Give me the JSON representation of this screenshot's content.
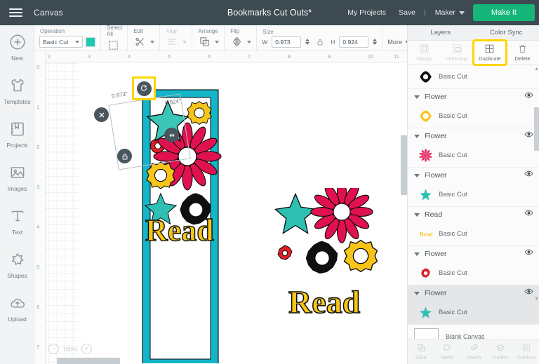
{
  "topbar": {
    "menu_icon": "hamburger-icon",
    "canvas_label": "Canvas",
    "doc_title": "Bookmarks Cut Outs*",
    "my_projects": "My Projects",
    "save": "Save",
    "separator": "|",
    "machine": "Maker",
    "make_it": "Make It",
    "accent_green": "#16b579",
    "bar_bg": "#3d4a51"
  },
  "rail": {
    "items": [
      {
        "label": "New",
        "icon": "plus-circle-icon"
      },
      {
        "label": "Templates",
        "icon": "shirt-icon"
      },
      {
        "label": "Projects",
        "icon": "book-icon"
      },
      {
        "label": "Images",
        "icon": "image-icon"
      },
      {
        "label": "Text",
        "icon": "text-t-icon"
      },
      {
        "label": "Shapes",
        "icon": "shapes-icon"
      },
      {
        "label": "Upload",
        "icon": "upload-cloud-icon"
      }
    ]
  },
  "toolbar": {
    "operation_label": "Operation",
    "operation_value": "Basic Cut",
    "operation_color": "#1fc9b0",
    "select_all_label": "Select All",
    "edit_label": "Edit",
    "align_label": "Align",
    "arrange_label": "Arrange",
    "flip_label": "Flip",
    "size_label": "Size",
    "w_label": "W",
    "w_value": "0.973",
    "h_label": "H",
    "h_value": "0.924",
    "lock_icon": "lock-icon",
    "more_label": "More"
  },
  "canvas": {
    "ruler_h": [
      "2",
      "3",
      "4",
      "5",
      "6",
      "7",
      "8",
      "9",
      "10",
      "11"
    ],
    "ruler_v": [
      "0",
      "1",
      "2",
      "3",
      "4",
      "5",
      "6",
      "7"
    ],
    "zoom_percent": "100%",
    "zoom_out_icon": "minus-circle-icon",
    "zoom_in_icon": "plus-circle-icon",
    "selection": {
      "width_label": "0.973\"",
      "height_label": "0.924\"",
      "delete_icon": "close-x-icon",
      "lock_icon": "lock-closed-icon",
      "resize_icon": "resize-diagonal-icon",
      "rotate_icon": "rotate-icon",
      "rotate_highlight_color": "#ffd400"
    },
    "artwork": {
      "bookmark_frame_color": "#14b5c9",
      "shapes": [
        {
          "name": "teal-star-flower",
          "color": "#2fc0b4"
        },
        {
          "name": "crimson-daisy",
          "color": "#e0114f"
        },
        {
          "name": "small-red-flower",
          "color": "#e01e28"
        },
        {
          "name": "black-flower",
          "color": "#101010"
        },
        {
          "name": "yellow-ring-flower",
          "color": "#f7c51a"
        },
        {
          "name": "read-word",
          "color": "#f7c51a",
          "text": "Read"
        }
      ]
    }
  },
  "right_panel": {
    "tabs": [
      {
        "label": "Layers"
      },
      {
        "label": "Color Sync"
      }
    ],
    "ops": [
      {
        "label": "Group",
        "icon": "group-icon",
        "enabled": false,
        "highlighted": false
      },
      {
        "label": "UnGroup",
        "icon": "ungroup-icon",
        "enabled": false,
        "highlighted": false
      },
      {
        "label": "Duplicate",
        "icon": "duplicate-icon",
        "enabled": true,
        "highlighted": true
      },
      {
        "label": "Delete",
        "icon": "trash-icon",
        "enabled": true,
        "highlighted": false
      }
    ],
    "layers": [
      {
        "name": "",
        "operation": "Basic Cut",
        "swatch": "#101010",
        "shape": "flower",
        "partial": true,
        "selected": false
      },
      {
        "name": "Flower",
        "operation": "Basic Cut",
        "swatch": "#f7c51a",
        "shape": "ring",
        "selected": false
      },
      {
        "name": "Flower",
        "operation": "Basic Cut",
        "swatch": "#e8396b",
        "shape": "daisy",
        "selected": false
      },
      {
        "name": "Flower",
        "operation": "Basic Cut",
        "swatch": "#2fc0b4",
        "shape": "star",
        "selected": false
      },
      {
        "name": "Read",
        "operation": "Basic Cut",
        "swatch": "#f7c51a",
        "shape": "text",
        "selected": false
      },
      {
        "name": "Flower",
        "operation": "Basic Cut",
        "swatch": "#e01e28",
        "shape": "small",
        "selected": false
      },
      {
        "name": "Flower",
        "operation": "Basic Cut",
        "swatch": "#2fc0b4",
        "shape": "star",
        "selected": true
      }
    ],
    "blank_canvas": "Blank Canvas",
    "bottom_ops": [
      {
        "label": "Slice",
        "icon": "slice-icon"
      },
      {
        "label": "Weld",
        "icon": "weld-icon"
      },
      {
        "label": "Attach",
        "icon": "paperclip-icon"
      },
      {
        "label": "Flatten",
        "icon": "flatten-icon"
      },
      {
        "label": "Contour",
        "icon": "contour-icon"
      }
    ]
  }
}
